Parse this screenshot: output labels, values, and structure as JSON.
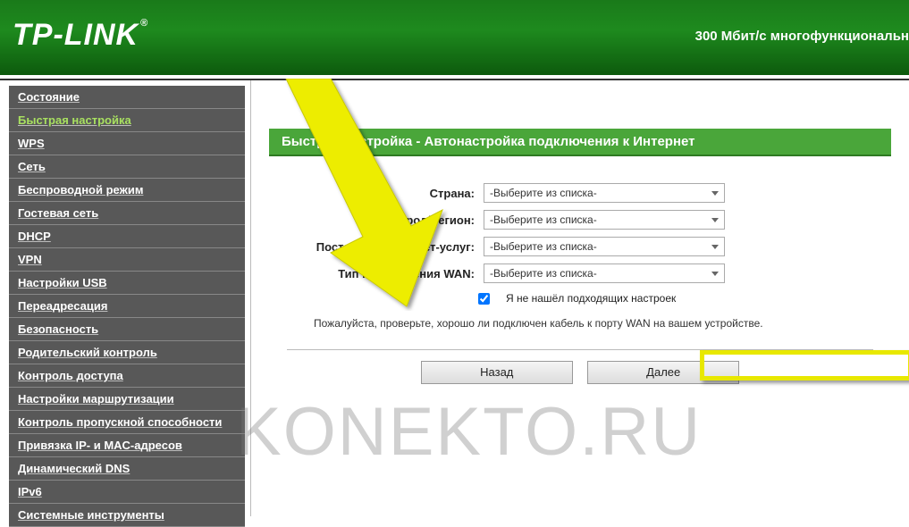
{
  "header": {
    "brand": "TP-LINK",
    "tagline": "300 Мбит/с многофункциональн"
  },
  "sidebar": {
    "items": [
      {
        "label": "Состояние"
      },
      {
        "label": "Быстрая настройка",
        "active": true
      },
      {
        "label": "WPS"
      },
      {
        "label": "Сеть"
      },
      {
        "label": "Беспроводной режим"
      },
      {
        "label": "Гостевая сеть"
      },
      {
        "label": "DHCP"
      },
      {
        "label": "VPN"
      },
      {
        "label": "Настройки USB"
      },
      {
        "label": "Переадресация"
      },
      {
        "label": "Безопасность"
      },
      {
        "label": "Родительский контроль"
      },
      {
        "label": "Контроль доступа"
      },
      {
        "label": "Настройки маршрутизации"
      },
      {
        "label": "Контроль пропускной способности"
      },
      {
        "label": "Привязка IP- и MAC-адресов"
      },
      {
        "label": "Динамический DNS"
      },
      {
        "label": "IPv6"
      },
      {
        "label": "Системные инструменты"
      }
    ]
  },
  "main": {
    "title": "Быстрая настройка - Автонастройка подключения к Интернет",
    "fields": {
      "country": {
        "label": "Страна:",
        "value": "-Выберите из списка-"
      },
      "region": {
        "label": "Город/Регион:",
        "value": "-Выберите из списка-"
      },
      "isp": {
        "label": "Поставщик интернет-услуг:",
        "value": "-Выберите из списка-"
      },
      "wan": {
        "label": "Тип подключения WAN:",
        "value": "-Выберите из списка-"
      }
    },
    "checkbox": {
      "label": "Я не нашёл подходящих настроек",
      "checked": true
    },
    "note": "Пожалуйста, проверьте, хорошо ли подключен кабель к порту WAN на вашем устройстве.",
    "buttons": {
      "back": "Назад",
      "next": "Далее"
    }
  },
  "watermark": "KONEKTO.RU",
  "colors": {
    "accent_green": "#4aa63a",
    "sidebar_active": "#a8e060",
    "highlight_yellow": "#e8e800"
  }
}
